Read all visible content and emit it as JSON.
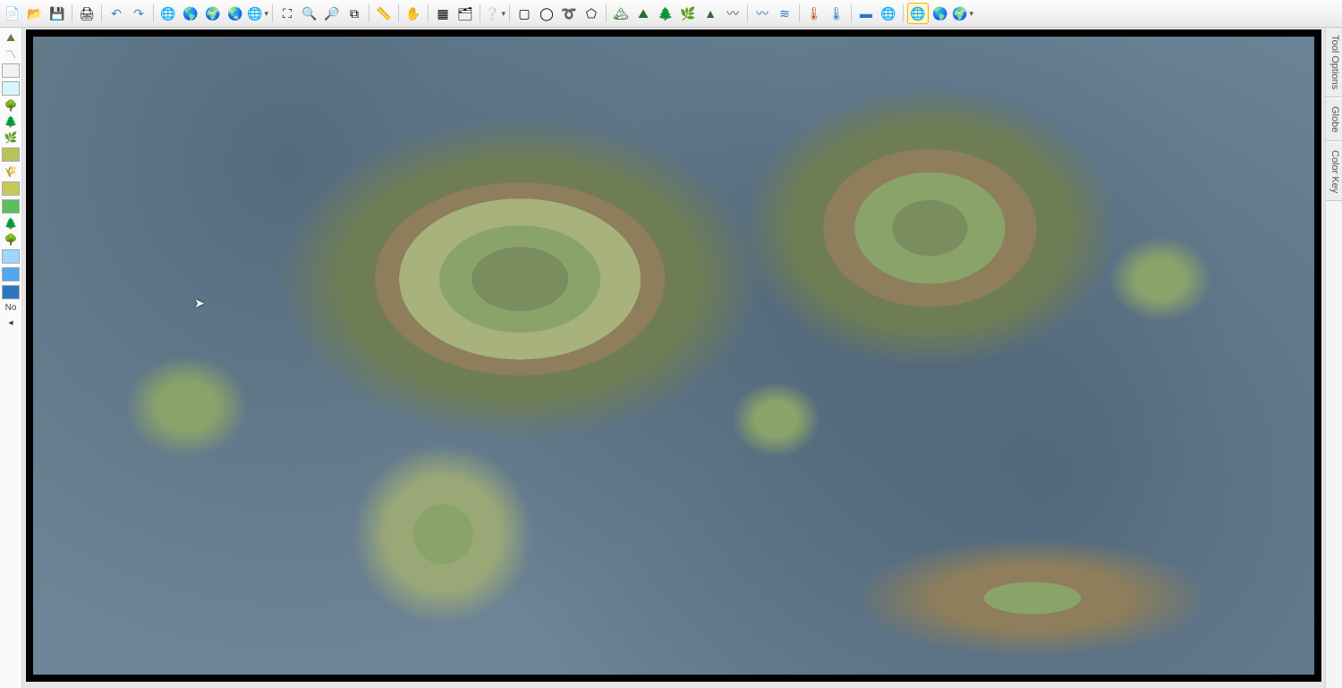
{
  "toolbar": {
    "groups": [
      {
        "items": [
          {
            "name": "new-file-icon",
            "glyph": "📄"
          },
          {
            "name": "open-file-icon",
            "glyph": "📂"
          },
          {
            "name": "save-icon",
            "glyph": "💾"
          }
        ]
      },
      {
        "items": [
          {
            "name": "print-icon",
            "glyph": "🖨"
          }
        ]
      },
      {
        "items": [
          {
            "name": "undo-icon",
            "glyph": "↶",
            "color": "#4a7ec8"
          },
          {
            "name": "redo-icon",
            "glyph": "↷",
            "color": "#4a7ec8"
          }
        ]
      },
      {
        "items": [
          {
            "name": "globe-icon",
            "glyph": "🌐"
          },
          {
            "name": "globe-brown-icon",
            "glyph": "🌎"
          },
          {
            "name": "globe-green-icon",
            "glyph": "🌍"
          },
          {
            "name": "globe-alt-icon",
            "glyph": "🌏"
          },
          {
            "name": "globe-more-icon",
            "glyph": "🌐",
            "caret": true
          }
        ]
      },
      {
        "items": [
          {
            "name": "zoom-extents-icon",
            "glyph": "⛶"
          },
          {
            "name": "zoom-in-icon",
            "glyph": "🔍"
          },
          {
            "name": "zoom-out-icon",
            "glyph": "🔎"
          },
          {
            "name": "zoom-window-icon",
            "glyph": "⧉"
          }
        ]
      },
      {
        "items": [
          {
            "name": "ruler-icon",
            "glyph": "📏"
          }
        ]
      },
      {
        "items": [
          {
            "name": "pan-icon",
            "glyph": "✋"
          }
        ]
      },
      {
        "items": [
          {
            "name": "grid-icon",
            "glyph": "▦"
          },
          {
            "name": "layers-icon",
            "glyph": "🗂"
          }
        ]
      },
      {
        "items": [
          {
            "name": "help-icon",
            "glyph": "❔",
            "caret": true
          }
        ]
      },
      {
        "items": [
          {
            "name": "select-rect-icon",
            "glyph": "▢"
          },
          {
            "name": "select-ellipse-icon",
            "glyph": "◯"
          },
          {
            "name": "select-lasso-icon",
            "glyph": "➰"
          },
          {
            "name": "select-poly-icon",
            "glyph": "⬠"
          }
        ]
      },
      {
        "items": [
          {
            "name": "terrain-mountain-icon",
            "glyph": "🏔",
            "color": "#2e6b2e"
          },
          {
            "name": "terrain-hill-icon",
            "glyph": "⛰",
            "color": "#2e6b2e"
          },
          {
            "name": "terrain-forest-icon",
            "glyph": "🌲",
            "color": "#2e6b2e"
          },
          {
            "name": "terrain-marsh-icon",
            "glyph": "🌿",
            "color": "#2e6b2e"
          },
          {
            "name": "terrain-desert-icon",
            "glyph": "▲",
            "color": "#2e6b2e"
          },
          {
            "name": "terrain-plains-icon",
            "glyph": "〰",
            "color": "#2e6b2e"
          }
        ]
      },
      {
        "items": [
          {
            "name": "river-tool-icon",
            "glyph": "〰",
            "color": "#2a76c0"
          },
          {
            "name": "river-edit-icon",
            "glyph": "≋",
            "color": "#2a76c0"
          }
        ]
      },
      {
        "items": [
          {
            "name": "temperature-up-icon",
            "glyph": "🌡",
            "color": "#c05020"
          },
          {
            "name": "temperature-down-icon",
            "glyph": "🌡",
            "color": "#2a76c0"
          }
        ]
      },
      {
        "items": [
          {
            "name": "ocean-tool-icon",
            "glyph": "▬",
            "color": "#2a76c0"
          },
          {
            "name": "planet-icon",
            "glyph": "🌐"
          }
        ]
      },
      {
        "items": [
          {
            "name": "render-highlight-icon",
            "glyph": "🌐",
            "highlight": true
          },
          {
            "name": "render-globe-icon",
            "glyph": "🌎"
          },
          {
            "name": "render-globe-alt-icon",
            "glyph": "🌍",
            "caret": true
          }
        ]
      }
    ]
  },
  "left_sidebar": {
    "items": [
      {
        "name": "layer-terrain-icon",
        "type": "glyph",
        "glyph": "⛰",
        "color": "#6b7a3e"
      },
      {
        "name": "layer-hills-icon",
        "type": "glyph",
        "glyph": "〽",
        "color": "#6b7a3e"
      },
      {
        "name": "layer-blank-swatch",
        "type": "swatch",
        "color": "#f2f2f2"
      },
      {
        "name": "layer-ice-swatch",
        "type": "swatch",
        "color": "#d9f4ff"
      },
      {
        "name": "layer-forest-icon",
        "type": "glyph",
        "glyph": "🌳",
        "color": "#2e7d2e"
      },
      {
        "name": "layer-pine-icon",
        "type": "glyph",
        "glyph": "🌲",
        "color": "#2e7d2e"
      },
      {
        "name": "layer-shrub-icon",
        "type": "glyph",
        "glyph": "🌿",
        "color": "#3a8a3a"
      },
      {
        "name": "layer-grass-swatch",
        "type": "swatch",
        "color": "#b9c25a"
      },
      {
        "name": "layer-savanna-icon",
        "type": "glyph",
        "glyph": "🌾",
        "color": "#6b7a3e"
      },
      {
        "name": "layer-dry-swatch",
        "type": "swatch",
        "color": "#c9c95a"
      },
      {
        "name": "layer-green-swatch",
        "type": "swatch",
        "color": "#5bbf5b"
      },
      {
        "name": "layer-darkforest-icon",
        "type": "glyph",
        "glyph": "🌲",
        "color": "#355535"
      },
      {
        "name": "layer-jungle-icon",
        "type": "glyph",
        "glyph": "🌳",
        "color": "#355535"
      },
      {
        "name": "layer-water-shallow-swatch",
        "type": "swatch",
        "color": "#9dd6ff"
      },
      {
        "name": "layer-water-mid-swatch",
        "type": "swatch",
        "color": "#4fa9f0"
      },
      {
        "name": "layer-water-deep-swatch",
        "type": "swatch",
        "color": "#2a76c0"
      }
    ],
    "no_label": "No",
    "collapse_glyph": "◂"
  },
  "right_sidebar": {
    "tabs": [
      {
        "name": "tool-options-tab",
        "label": "Tool Options"
      },
      {
        "name": "globe-tab",
        "label": "Globe"
      },
      {
        "name": "color-key-tab",
        "label": "Color Key"
      }
    ]
  },
  "canvas": {
    "cursor_glyph": "➤"
  }
}
